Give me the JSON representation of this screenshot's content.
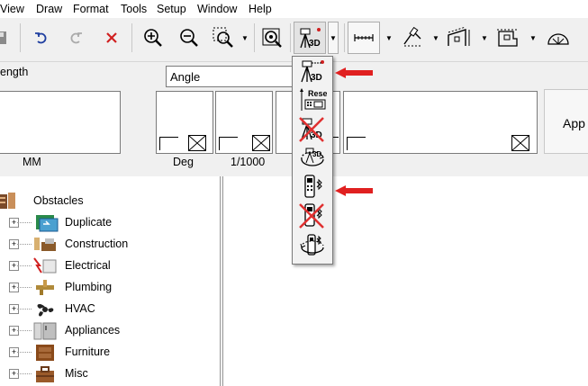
{
  "menu": [
    "View",
    "Draw",
    "Format",
    "Tools",
    "Setup",
    "Window",
    "Help"
  ],
  "measure": {
    "length_label": "ength",
    "angle_value": "Angle",
    "unit_mm": "MM",
    "unit_deg": "Deg",
    "unit_ratio": "1/1000",
    "apply_label": "App"
  },
  "tree": {
    "items": [
      {
        "label": "Obstacles",
        "icon": "obstacles-icon"
      },
      {
        "label": "Duplicate",
        "icon": "duplicate-icon"
      },
      {
        "label": "Construction",
        "icon": "construction-icon"
      },
      {
        "label": "Electrical",
        "icon": "electrical-icon"
      },
      {
        "label": "Plumbing",
        "icon": "plumbing-icon"
      },
      {
        "label": "HVAC",
        "icon": "hvac-icon"
      },
      {
        "label": "Appliances",
        "icon": "appliances-icon"
      },
      {
        "label": "Furniture",
        "icon": "furniture-icon"
      },
      {
        "label": "Misc",
        "icon": "misc-icon"
      }
    ],
    "close_glyph": "×",
    "expand_glyph": "+"
  },
  "dropdown": {
    "items": [
      {
        "name": "tripod-3d-icon",
        "text": "3D"
      },
      {
        "name": "reset-icon",
        "text": "Reset"
      },
      {
        "name": "tripod-3d-disabled-icon",
        "text": "3D"
      },
      {
        "name": "tripod-rotate-icon",
        "text": "3D"
      },
      {
        "name": "bluetooth-device-icon",
        "text": ""
      },
      {
        "name": "bluetooth-device-disabled-icon",
        "text": ""
      },
      {
        "name": "device-rotate-icon",
        "text": ""
      }
    ]
  },
  "colors": {
    "annotation_arrow": "#e02020",
    "disabled_x": "#e03030"
  }
}
